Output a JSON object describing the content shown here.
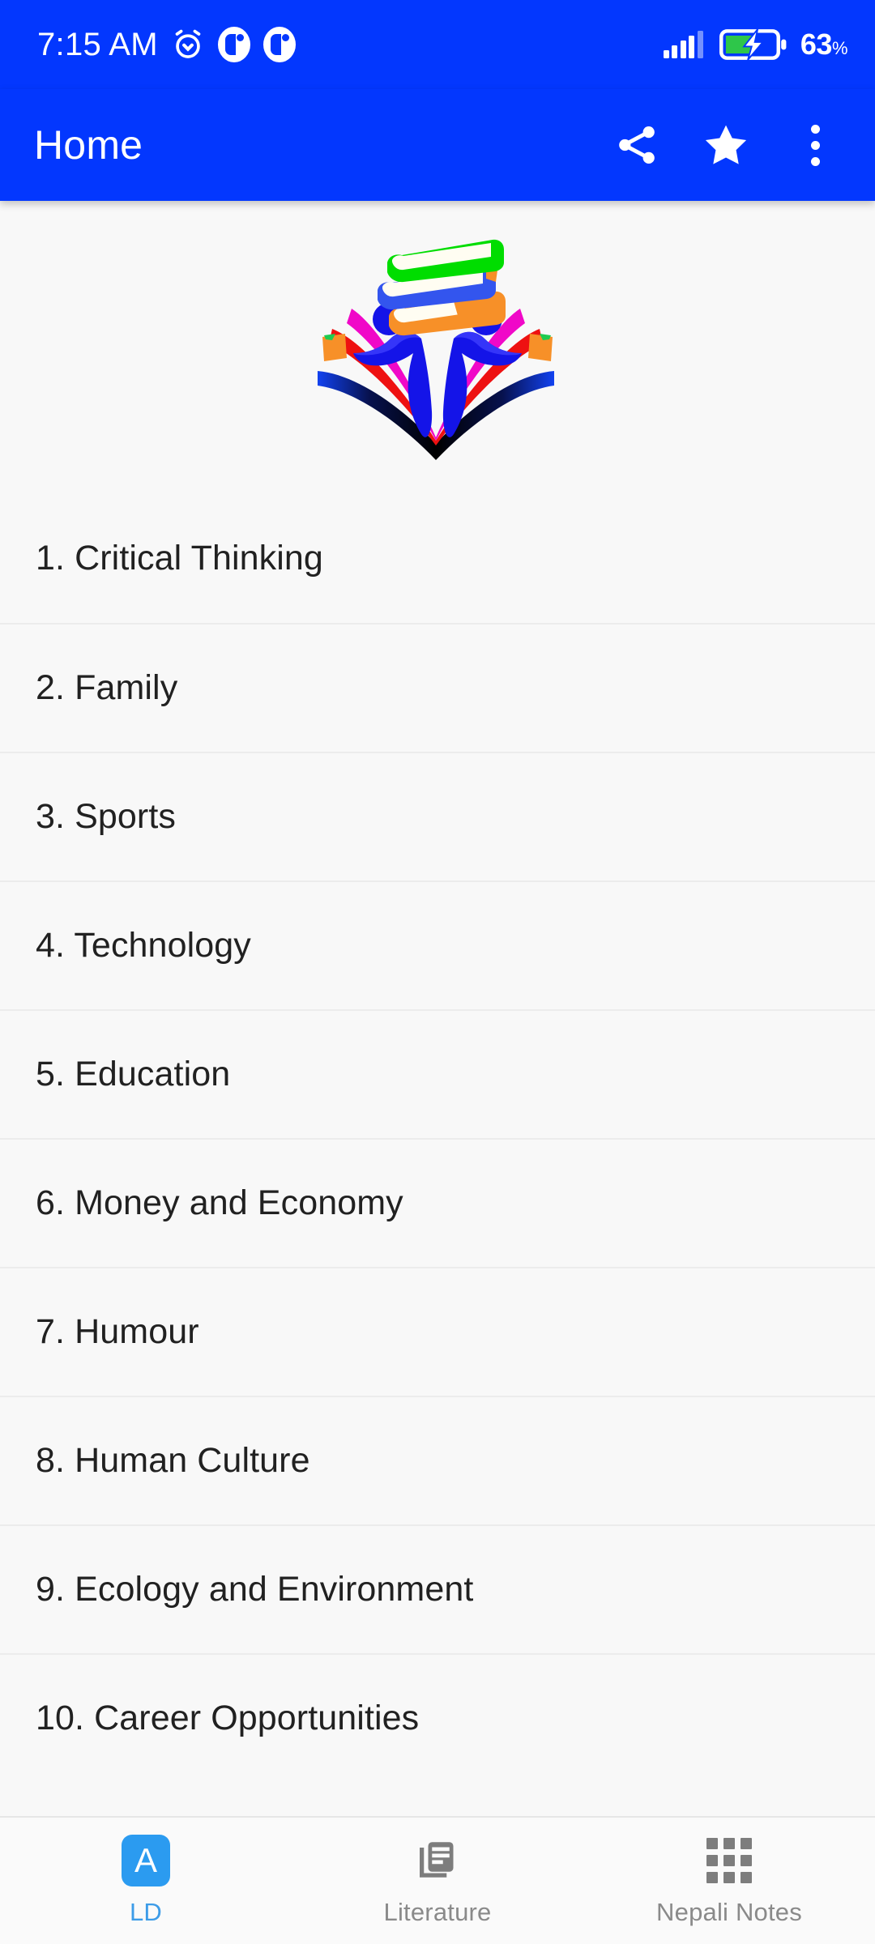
{
  "status_bar": {
    "time": "7:15 AM",
    "icons": [
      "alarm-icon",
      "app-notification-icon",
      "app-notification-icon"
    ],
    "signal_icon": "signal-bars-icon",
    "battery_icon": "battery-charging-icon",
    "battery_percent": "63",
    "battery_percent_symbol": "%",
    "background_color": "#0337FE"
  },
  "app_bar": {
    "title": "Home",
    "background_color": "#0337FE",
    "actions": [
      {
        "name": "share-icon",
        "label": "Share"
      },
      {
        "name": "star-icon",
        "label": "Favorite"
      },
      {
        "name": "overflow-menu-icon",
        "label": "More options"
      }
    ]
  },
  "logo": {
    "name": "app-logo",
    "description": "Stacked books above two figures holding books over an open book",
    "colors": {
      "book_top": "#00DD00",
      "book_middle": "#3355EE",
      "book_bottom": "#F79028",
      "figures": "#1414E8",
      "page_magenta": "#F008C8",
      "page_red": "#EE1111",
      "page_blue": "#0F3BE8",
      "page_black": "#000000"
    }
  },
  "list": {
    "items": [
      {
        "label": "1. Critical Thinking"
      },
      {
        "label": "2. Family"
      },
      {
        "label": "3. Sports"
      },
      {
        "label": "4. Technology"
      },
      {
        "label": "5. Education"
      },
      {
        "label": "6. Money and Economy"
      },
      {
        "label": "7. Humour"
      },
      {
        "label": "8. Human Culture"
      },
      {
        "label": "9. Ecology and Environment"
      },
      {
        "label": "10. Career Opportunities"
      }
    ]
  },
  "bottom_nav": {
    "active_color": "#3d9ce8",
    "inactive_color": "#8a8a8a",
    "items": [
      {
        "label": "LD",
        "icon": "ld-badge-icon",
        "badge_letter": "A",
        "active": true
      },
      {
        "label": "Literature",
        "icon": "library-books-icon",
        "active": false
      },
      {
        "label": "Nepali Notes",
        "icon": "grid-apps-icon",
        "active": false
      }
    ]
  }
}
